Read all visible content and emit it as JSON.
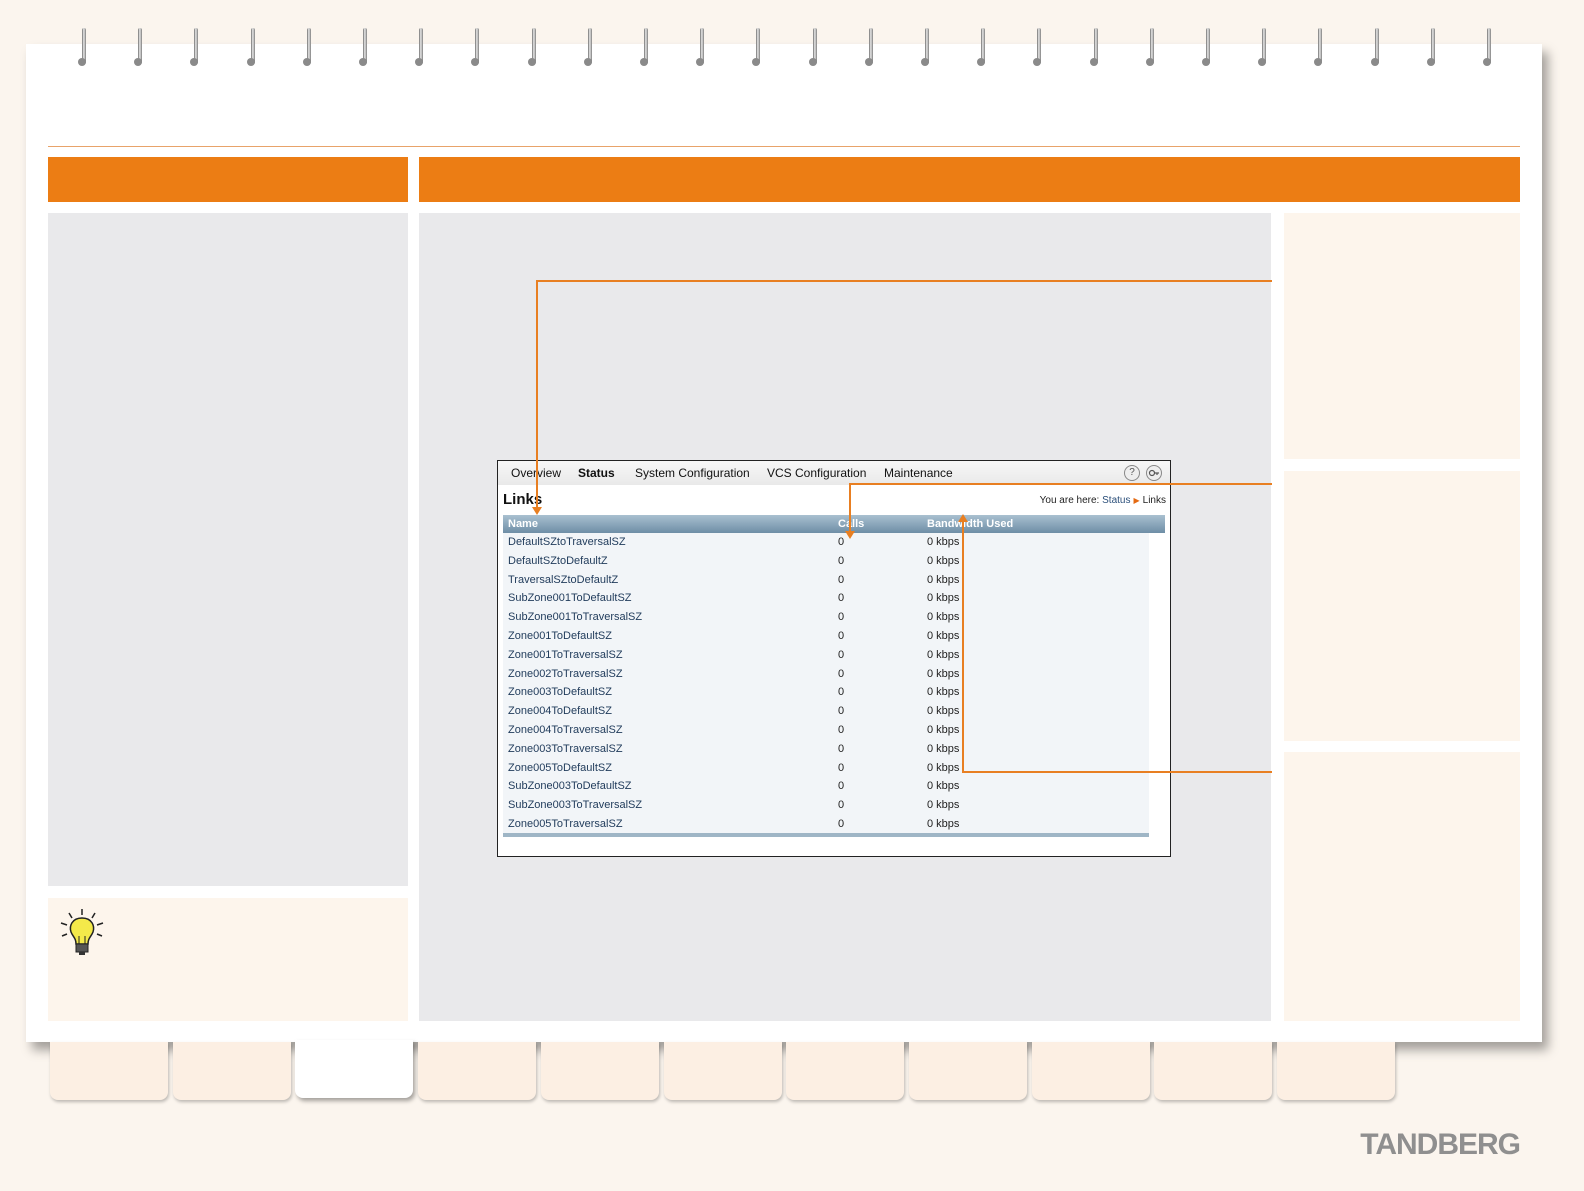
{
  "screenshot": {
    "menu": [
      "Overview",
      "Status",
      "System Configuration",
      "VCS Configuration",
      "Maintenance"
    ],
    "active_menu": "Status",
    "help_icon": "?",
    "page_title": "Links",
    "breadcrumb": {
      "prefix": "You are here:",
      "section": "Status",
      "page": "Links"
    },
    "columns": [
      "Name",
      "Calls",
      "Bandwidth Used"
    ],
    "rows": [
      {
        "name": "DefaultSZtoTraversalSZ",
        "calls": "0",
        "bandwidth": "0 kbps"
      },
      {
        "name": "DefaultSZtoDefaultZ",
        "calls": "0",
        "bandwidth": "0 kbps"
      },
      {
        "name": "TraversalSZtoDefaultZ",
        "calls": "0",
        "bandwidth": "0 kbps"
      },
      {
        "name": "SubZone001ToDefaultSZ",
        "calls": "0",
        "bandwidth": "0 kbps"
      },
      {
        "name": "SubZone001ToTraversalSZ",
        "calls": "0",
        "bandwidth": "0 kbps"
      },
      {
        "name": "Zone001ToDefaultSZ",
        "calls": "0",
        "bandwidth": "0 kbps"
      },
      {
        "name": "Zone001ToTraversalSZ",
        "calls": "0",
        "bandwidth": "0 kbps"
      },
      {
        "name": "Zone002ToTraversalSZ",
        "calls": "0",
        "bandwidth": "0 kbps"
      },
      {
        "name": "Zone003ToDefaultSZ",
        "calls": "0",
        "bandwidth": "0 kbps"
      },
      {
        "name": "Zone004ToDefaultSZ",
        "calls": "0",
        "bandwidth": "0 kbps"
      },
      {
        "name": "Zone004ToTraversalSZ",
        "calls": "0",
        "bandwidth": "0 kbps"
      },
      {
        "name": "Zone003ToTraversalSZ",
        "calls": "0",
        "bandwidth": "0 kbps"
      },
      {
        "name": "Zone005ToDefaultSZ",
        "calls": "0",
        "bandwidth": "0 kbps"
      },
      {
        "name": "SubZone003ToDefaultSZ",
        "calls": "0",
        "bandwidth": "0 kbps"
      },
      {
        "name": "SubZone003ToTraversalSZ",
        "calls": "0",
        "bandwidth": "0 kbps"
      },
      {
        "name": "Zone005ToTraversalSZ",
        "calls": "0",
        "bandwidth": "0 kbps"
      }
    ]
  },
  "brand": "TANDBERG",
  "colors": {
    "accent": "#ec7d14",
    "panel": "#e9e9eb",
    "peach": "#fdf5ec",
    "table_header": "#6e8ea6",
    "link": "#2b4f7a"
  },
  "icons": [
    "lightbulb-icon",
    "help-icon",
    "logout-icon",
    "breadcrumb-arrow-icon"
  ]
}
